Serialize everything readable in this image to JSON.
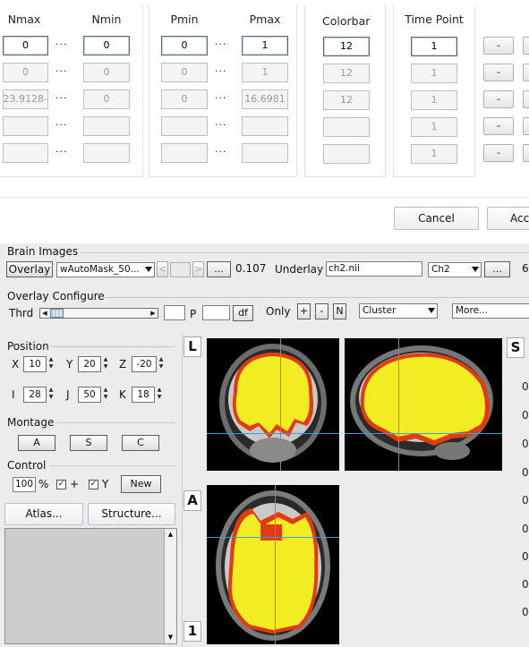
{
  "dialog": {
    "headers": {
      "nmax": "Nmax",
      "nmin": "Nmin",
      "pmin": "Pmin",
      "pmax": "Pmax",
      "colorbar": "Colorbar",
      "timepoint": "Time Point"
    },
    "separator": "···",
    "rows": [
      {
        "nmax": "0",
        "nmin": "0",
        "pmin": "0",
        "pmax": "1",
        "colorbar": "12",
        "timepoint": "1"
      },
      {
        "nmax": "0",
        "nmin": "0",
        "pmin": "0",
        "pmax": "1",
        "colorbar": "12",
        "timepoint": "1"
      },
      {
        "nmax": "-23.9128",
        "nmin": "0",
        "pmin": "0",
        "pmax": "16.6981",
        "colorbar": "12",
        "timepoint": "1"
      },
      {
        "nmax": "",
        "nmin": "",
        "pmin": "",
        "pmax": "",
        "colorbar": "",
        "timepoint": "1"
      },
      {
        "nmax": "",
        "nmin": "",
        "pmin": "",
        "pmax": "",
        "colorbar": "",
        "timepoint": "1"
      }
    ],
    "side_button_label": "-",
    "cancel_label": "Cancel",
    "accept_label": "Acc"
  },
  "brain_images": {
    "title": "Brain Images",
    "overlay_label": "Overlay",
    "overlay_file": "wAutoMask_50...",
    "prev_symbol": "<",
    "next_symbol": ">",
    "browse_label": "...",
    "threshold_value": "0.107",
    "underlay_label": "Underlay",
    "underlay_file": "ch2.nii",
    "underlay_template": "Ch2",
    "cut_text": "6"
  },
  "overlay_configure": {
    "title": "Overlay Configure",
    "thrd_label": "Thrd",
    "p_label": "P",
    "df_label": "df",
    "only_label": "Only",
    "plus_label": "+",
    "minus_label": "-",
    "n_label": "N",
    "cluster_option": "Cluster",
    "more_option": "More..."
  },
  "position": {
    "title": "Position",
    "x_label": "X",
    "x_value": "10",
    "y_label": "Y",
    "y_value": "20",
    "z_label": "Z",
    "z_value": "-20",
    "i_label": "I",
    "i_value": "28",
    "j_label": "J",
    "j_value": "50",
    "k_label": "K",
    "k_value": "18"
  },
  "montage": {
    "title": "Montage",
    "a_label": "A",
    "s_label": "S",
    "c_label": "C"
  },
  "control": {
    "title": "Control",
    "zoom_value": "100",
    "percent": "%",
    "plus_label": "+",
    "y_label": "Y",
    "new_label": "New",
    "check_mark": "✓"
  },
  "atlas_label": "Atlas...",
  "structure_label": "Structure...",
  "views": {
    "l_label": "L",
    "a_label": "A",
    "one_label": "1",
    "s_label": "S"
  },
  "right_values": [
    "0",
    "0",
    "0",
    "0",
    "0",
    "0",
    "0",
    "0",
    "0"
  ],
  "colors": {
    "overlay": "#f2ec22",
    "edge": "#e23b12",
    "crosshair": "#3aa0dc",
    "panel_bg": "#ececec"
  }
}
